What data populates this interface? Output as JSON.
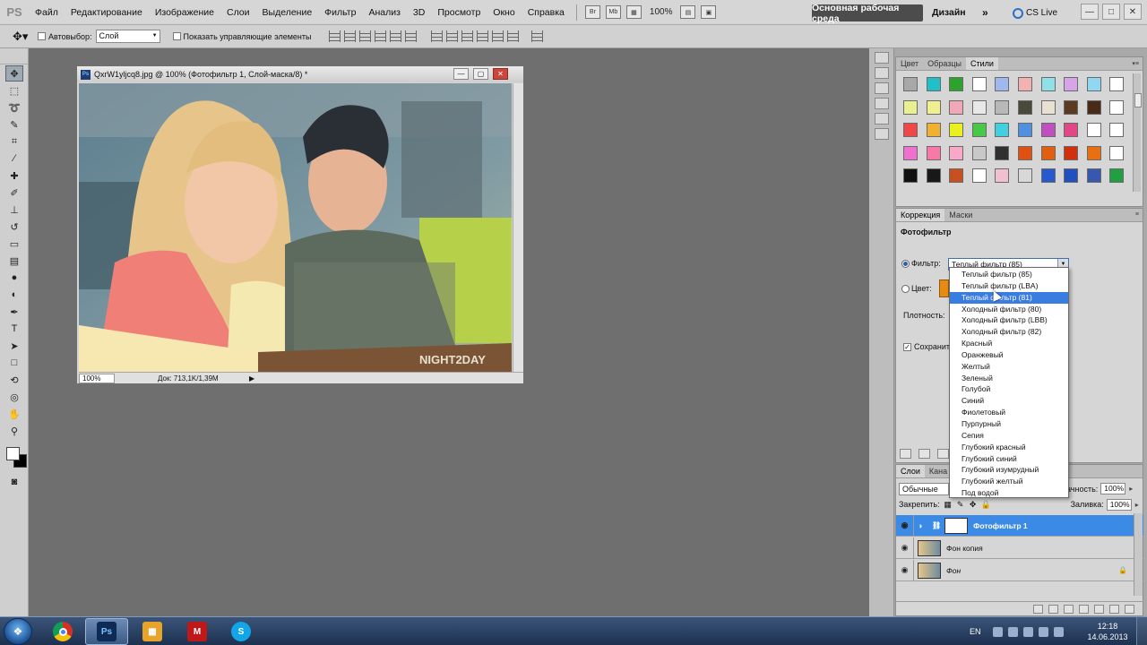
{
  "app": {
    "logo": "PS"
  },
  "menu": [
    "Файл",
    "Редактирование",
    "Изображение",
    "Слои",
    "Выделение",
    "Фильтр",
    "Анализ",
    "3D",
    "Просмотр",
    "Окно",
    "Справка"
  ],
  "menubar": {
    "bridge_label": "Br",
    "minibridge_label": "Mb",
    "zoom": "100%",
    "workspace_label": "Основная рабочая среда",
    "design_label": "Дизайн",
    "more_label": "»",
    "cslive_label": "CS Live"
  },
  "optionsbar": {
    "autoselect_label": "Автовыбор:",
    "autoselect_value": "Слой",
    "show_controls_label": "Показать управляющие элементы"
  },
  "document": {
    "title": "QxrW1yljcq8.jpg @ 100% (Фотофильтр 1, Слой-маска/8) *",
    "watermark": "NIGHT2DAY",
    "zoom": "100%",
    "doc_info": "Док: 713,1K/1,39M"
  },
  "styles_panel": {
    "tabs": [
      "Цвет",
      "Образцы",
      "Стили"
    ],
    "active_tab": "Стили",
    "swatch_colors": [
      "#a8a8a8",
      "#1fc0c8",
      "#2da32d",
      "#ffffff",
      "#9fb8ee",
      "#f3b1b1",
      "#8fe0e8",
      "#d8a4e8",
      "#8fd8f0",
      "#ffffff",
      "#e8f090",
      "#f0f090",
      "#f0a8b8",
      "#e8e8e8",
      "#b8b8b8",
      "#4a4a3a",
      "#e8e0d0",
      "#5a3a20",
      "#4a2a18",
      "#ffffff",
      "#f04848",
      "#f0b030",
      "#e8f020",
      "#48c848",
      "#40d0e0",
      "#5090e0",
      "#c050c0",
      "#e04888",
      "#ffffff",
      "#ffffff",
      "#f070d0",
      "#f878a8",
      "#f8a8c8",
      "#c8c8c8",
      "#303030",
      "#e05010",
      "#e06010",
      "#d03010",
      "#e87010",
      "#ffffff",
      "#101010",
      "#181818",
      "#c85020",
      "#ffffff",
      "#f0c0d0",
      "#d8d8d8",
      "#2858d0",
      "#2050c0",
      "#3858b0",
      "#20a040"
    ]
  },
  "correction_panel": {
    "tabs": [
      "Коррекция",
      "Маски"
    ],
    "active_tab": "Коррекция",
    "title": "Фотофильтр",
    "filter_label": "Фильтр:",
    "filter_value": "Теплый фильтр (85)",
    "color_label": "Цвет:",
    "color_value": "#e88a12",
    "density_label": "Плотность:",
    "preserve_label": "Сохранить"
  },
  "filter_dropdown": {
    "options": [
      "Теплый фильтр (85)",
      "Теплый фильтр (LBA)",
      "Теплый фильтр (81)",
      "Холодный фильтр (80)",
      "Холодный фильтр (LBB)",
      "Холодный фильтр (82)",
      "Красный",
      "Оранжевый",
      "Желтый",
      "Зеленый",
      "Голубой",
      "Синий",
      "Фиолетовый",
      "Пурпурный",
      "Сепия",
      "Глубокий красный",
      "Глубокий синий",
      "Глубокий изумрудный",
      "Глубокий желтый",
      "Под водой"
    ],
    "highlighted": "Теплый фильтр (81)"
  },
  "layers_panel": {
    "tabs": [
      "Слои",
      "Кана"
    ],
    "active_tab": "Слои",
    "blend_mode": "Обычные",
    "opacity_label": "ачность:",
    "opacity_value": "100%",
    "lock_label": "Закрепить:",
    "fill_label": "Заливка:",
    "fill_value": "100%",
    "layers": [
      {
        "name": "Фотофильтр 1",
        "selected": true
      },
      {
        "name": "Фон копия",
        "selected": false
      },
      {
        "name": "Фон",
        "selected": false
      }
    ]
  },
  "taskbar": {
    "language": "EN",
    "time": "12:18",
    "date": "14.06.2013",
    "apps": [
      "chrome",
      "photoshop",
      "file-manager",
      "mcafee",
      "skype"
    ],
    "ps_label": "Ps"
  }
}
